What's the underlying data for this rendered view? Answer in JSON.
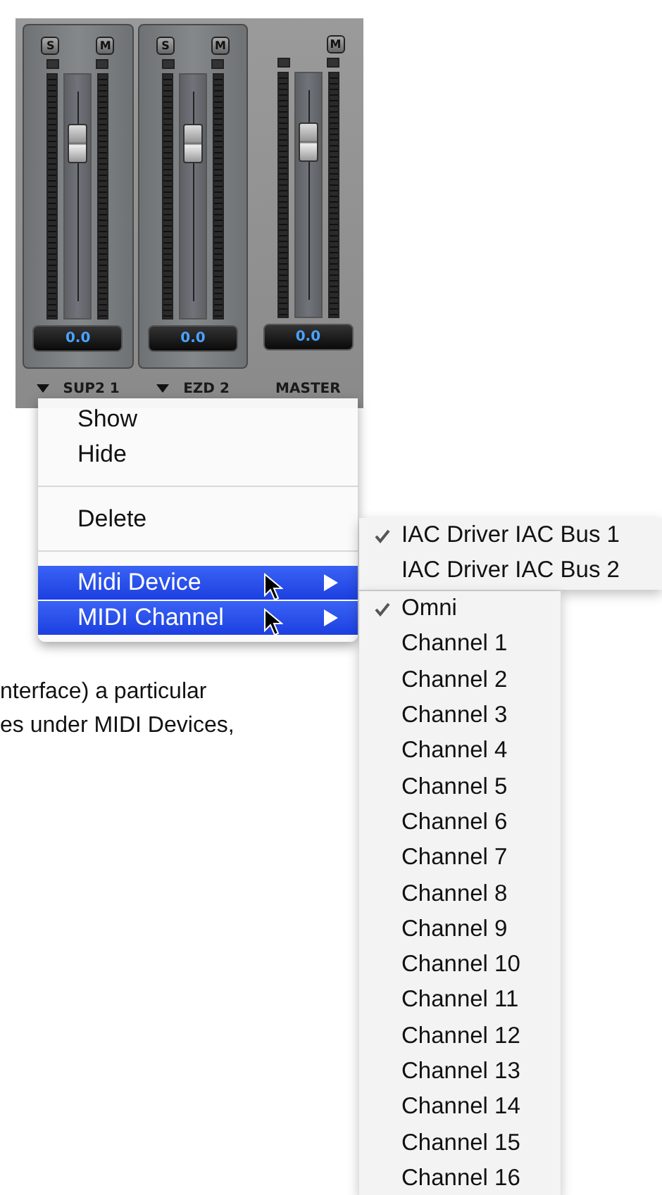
{
  "mixer": {
    "channels": [
      {
        "name": "SUP2 1",
        "has_menu": true,
        "solo_label": "S",
        "mute_label": "M",
        "value": "0.0",
        "level": 0.76
      },
      {
        "name": "EZD 2",
        "has_menu": true,
        "solo_label": "S",
        "mute_label": "M",
        "value": "0.0",
        "level": 0.76
      },
      {
        "name": "MASTER",
        "has_menu": false,
        "mute_label": "M",
        "value": "0.0",
        "level": 0.76
      }
    ]
  },
  "body_text": [
    "nterface) a particular",
    "es under MIDI Devices,"
  ],
  "context_menu": {
    "items": [
      {
        "kind": "item",
        "label": "Show",
        "selected": false
      },
      {
        "kind": "item",
        "label": "Hide",
        "selected": false
      },
      {
        "kind": "separator"
      },
      {
        "kind": "item",
        "label": "Delete",
        "selected": false
      },
      {
        "kind": "separator"
      },
      {
        "kind": "submenu",
        "label": "Midi Device",
        "selected": true,
        "cursor": true
      },
      {
        "kind": "submenu",
        "label": "MIDI Channel",
        "selected": true,
        "cursor": true
      }
    ]
  },
  "device_menu": {
    "items": [
      {
        "label": "IAC Driver IAC Bus 1",
        "checked": true
      },
      {
        "label": "IAC Driver IAC Bus 2",
        "checked": false
      }
    ]
  },
  "channel_menu": {
    "items": [
      {
        "label": "Omni",
        "checked": true
      },
      {
        "label": "Channel 1",
        "checked": false
      },
      {
        "label": "Channel 2",
        "checked": false
      },
      {
        "label": "Channel 3",
        "checked": false
      },
      {
        "label": "Channel 4",
        "checked": false
      },
      {
        "label": "Channel 5",
        "checked": false
      },
      {
        "label": "Channel 6",
        "checked": false
      },
      {
        "label": "Channel 7",
        "checked": false
      },
      {
        "label": "Channel 8",
        "checked": false
      },
      {
        "label": "Channel 9",
        "checked": false
      },
      {
        "label": "Channel 10",
        "checked": false
      },
      {
        "label": "Channel 11",
        "checked": false
      },
      {
        "label": "Channel 12",
        "checked": false
      },
      {
        "label": "Channel 13",
        "checked": false
      },
      {
        "label": "Channel 14",
        "checked": false
      },
      {
        "label": "Channel 15",
        "checked": false
      },
      {
        "label": "Channel 16",
        "checked": false
      }
    ]
  }
}
